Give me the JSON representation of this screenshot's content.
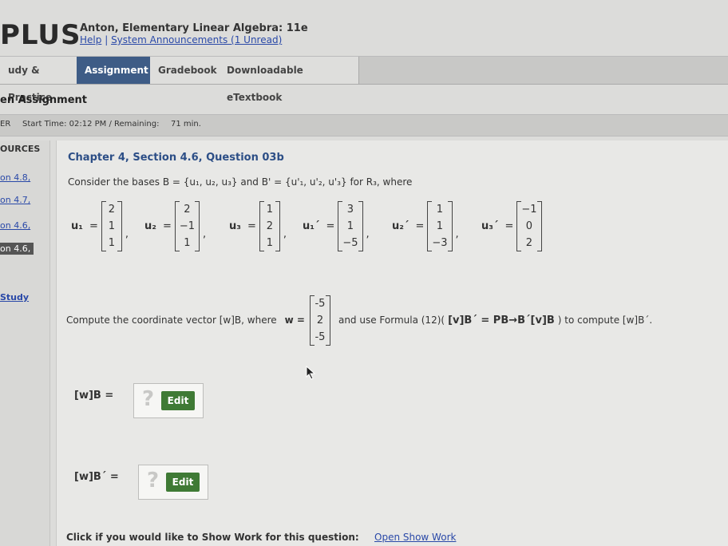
{
  "header": {
    "brand": "PLUS",
    "course_title": "Anton, Elementary Linear Algebra: 11e",
    "help": "Help",
    "separator": "|",
    "announcements": "System Announcements (1 Unread)"
  },
  "tabs": [
    {
      "label": "udy & Practice",
      "active": false
    },
    {
      "label": "Assignment",
      "active": true
    },
    {
      "label": "Gradebook",
      "active": false
    },
    {
      "label": "Downloadable eTextbook",
      "active": false
    }
  ],
  "page_heading": "en Assignment",
  "timer": {
    "prefix": "ER",
    "start_time": "Start Time: 02:12 PM / Remaining:",
    "remaining": "71 min."
  },
  "sidebar": {
    "title": "OURCES",
    "links": [
      "on 4.8,",
      "on 4.7,",
      "on 4.6,",
      "on 4.6,"
    ],
    "study": "Study"
  },
  "question": {
    "title": "Chapter 4, Section 4.6, Question 03b",
    "prompt": "Consider the bases B = {u₁, u₂, u₃} and B' = {u'₁, u'₂, u'₃} for R₃, where",
    "vectors": [
      {
        "name": "u₁",
        "values": [
          "2",
          "1",
          "1"
        ]
      },
      {
        "name": "u₂",
        "values": [
          "2",
          "−1",
          "1"
        ]
      },
      {
        "name": "u₃",
        "values": [
          "1",
          "2",
          "1"
        ]
      },
      {
        "name": "u₁´",
        "values": [
          "3",
          "1",
          "−5"
        ]
      },
      {
        "name": "u₂´",
        "values": [
          "1",
          "1",
          "−3"
        ]
      },
      {
        "name": "u₃´",
        "values": [
          "−1",
          "0",
          "2"
        ]
      }
    ],
    "compute_text": "Compute the coordinate vector [w]B, where",
    "w_label": "w =",
    "w_values": [
      "-5",
      "2",
      "-5"
    ],
    "formula_text": "and use Formula (12)(",
    "formula_eq": "[v]B´ = PB→B´[v]B",
    "formula_tail": ") to compute [w]B´."
  },
  "answers": [
    {
      "label": "[w]B  =",
      "qmark": "?",
      "button": "Edit"
    },
    {
      "label": "[w]B´  =",
      "qmark": "?",
      "button": "Edit"
    }
  ],
  "show_work": {
    "text": "Click if you would like to Show Work for this question:",
    "link": "Open Show Work"
  },
  "colors": {
    "active_tab": "#3e5c86",
    "edit_button": "#3f7a35",
    "link": "#2a49a8",
    "heading": "#2c4e86"
  }
}
